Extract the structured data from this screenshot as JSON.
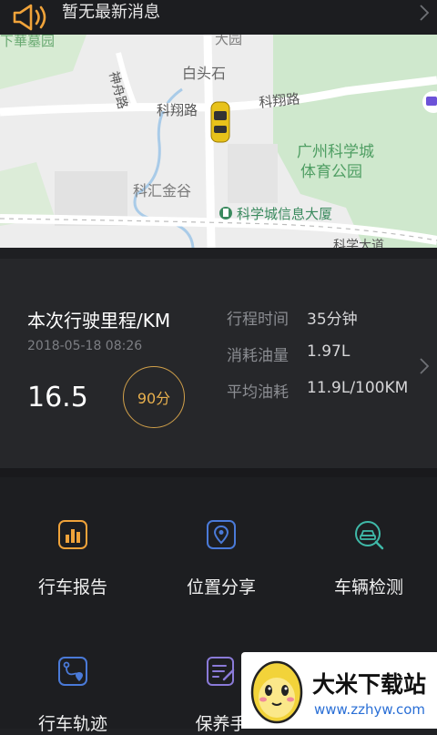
{
  "notice": {
    "text": "暂无最新消息",
    "icon": "megaphone-icon"
  },
  "map": {
    "labels": {
      "shenzhou_road": "神舟路",
      "baitoushi": "白头石",
      "kexiang_road_left": "科翔路",
      "kexiang_road_right": "科翔路",
      "park": "广州科学城体育公园",
      "park_line1": "广州科学城",
      "park_line2": "体育公园",
      "kehui": "科汇金谷",
      "info_building": "科学城信息大厦",
      "kexue_avenue": "科学大道"
    }
  },
  "trip": {
    "mileage_label": "本次行驶里程/KM",
    "date": "2018-05-18 08:26",
    "distance": "16.5",
    "score": "90分",
    "stats": [
      {
        "label": "行程时间",
        "value": "35分钟"
      },
      {
        "label": "消耗油量",
        "value": "1.97L"
      },
      {
        "label": "平均油耗",
        "value": "11.9L/100KM"
      }
    ]
  },
  "menu": {
    "items": [
      {
        "label": "行车报告",
        "icon": "report-chart-icon",
        "color": "#f0a33a"
      },
      {
        "label": "位置分享",
        "icon": "location-pin-icon",
        "color": "#4a7ad8"
      },
      {
        "label": "车辆检测",
        "icon": "car-search-icon",
        "color": "#3fb9a8"
      },
      {
        "label": "行车轨迹",
        "icon": "route-track-icon",
        "color": "#4a7ad8"
      },
      {
        "label": "保养手",
        "icon": "maintenance-notes-icon",
        "color": "#8a7ad8"
      }
    ]
  },
  "watermark": {
    "title": "大米下载站",
    "url": "www.zzhyw.com"
  },
  "colors": {
    "accent": "#e8b04e",
    "background": "#202124"
  }
}
